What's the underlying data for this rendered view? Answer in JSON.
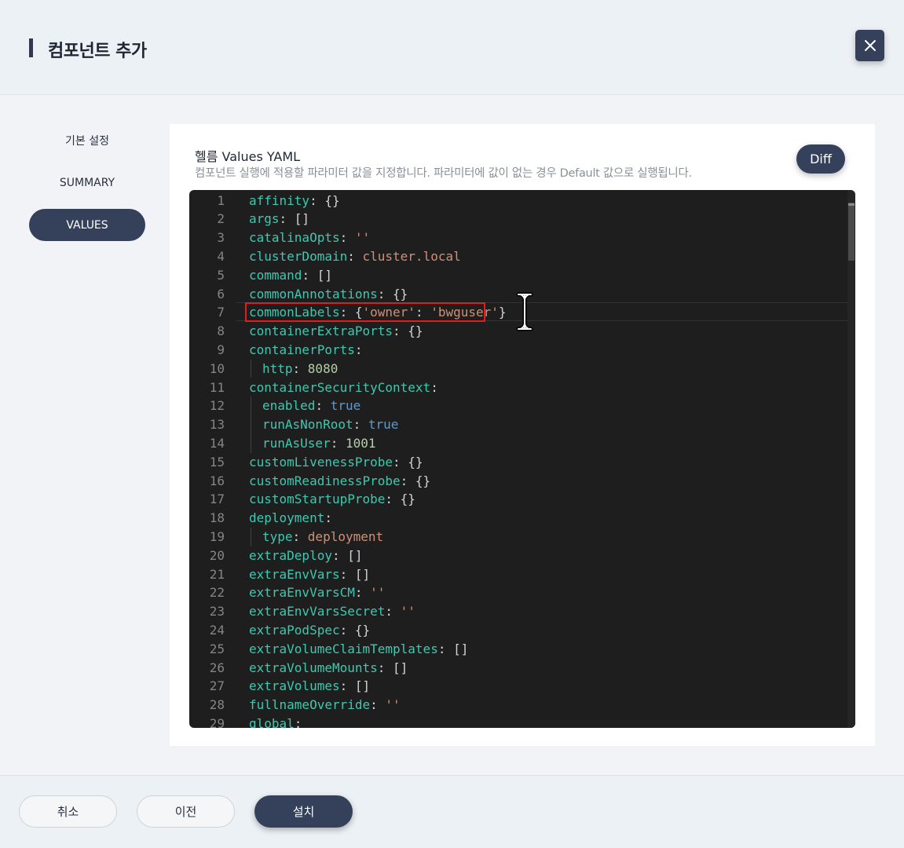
{
  "header": {
    "title": "컴포넌트 추가",
    "close_icon": "close-icon"
  },
  "sidebar": {
    "items": [
      {
        "label": "기본 설정",
        "active": false
      },
      {
        "label": "SUMMARY",
        "active": false
      },
      {
        "label": "VALUES",
        "active": true
      }
    ]
  },
  "panel": {
    "title": "헬름 Values YAML",
    "description": "컴포넌트 실행에 적용할 파라미터 값을 지정합니다. 파라미터에 값이 없는 경우 Default 값으로 실행됩니다.",
    "diff_label": "Diff"
  },
  "editor": {
    "highlighted_line": 7,
    "lines": [
      {
        "n": "1",
        "indent": false,
        "tokens": [
          [
            "k",
            "affinity"
          ],
          [
            "p",
            ": {}"
          ]
        ]
      },
      {
        "n": "2",
        "indent": false,
        "tokens": [
          [
            "k",
            "args"
          ],
          [
            "p",
            ": []"
          ]
        ]
      },
      {
        "n": "3",
        "indent": false,
        "tokens": [
          [
            "k",
            "catalinaOpts"
          ],
          [
            "p",
            ": "
          ],
          [
            "s",
            "''"
          ]
        ]
      },
      {
        "n": "4",
        "indent": false,
        "tokens": [
          [
            "k",
            "clusterDomain"
          ],
          [
            "p",
            ": "
          ],
          [
            "s",
            "cluster.local"
          ]
        ]
      },
      {
        "n": "5",
        "indent": false,
        "tokens": [
          [
            "k",
            "command"
          ],
          [
            "p",
            ": []"
          ]
        ]
      },
      {
        "n": "6",
        "indent": false,
        "tokens": [
          [
            "k",
            "commonAnnotations"
          ],
          [
            "p",
            ": {}"
          ]
        ]
      },
      {
        "n": "7",
        "indent": false,
        "tokens": [
          [
            "k",
            "commonLabels"
          ],
          [
            "p",
            ": {"
          ],
          [
            "s",
            "'owner'"
          ],
          [
            "p",
            ": "
          ],
          [
            "s",
            "'bwguser'"
          ],
          [
            "p",
            "}"
          ]
        ]
      },
      {
        "n": "8",
        "indent": false,
        "tokens": [
          [
            "k",
            "containerExtraPorts"
          ],
          [
            "p",
            ": {}"
          ]
        ]
      },
      {
        "n": "9",
        "indent": false,
        "tokens": [
          [
            "k",
            "containerPorts"
          ],
          [
            "p",
            ":"
          ]
        ]
      },
      {
        "n": "10",
        "indent": true,
        "tokens": [
          [
            "k",
            "http"
          ],
          [
            "p",
            ": "
          ],
          [
            "n",
            "8080"
          ]
        ]
      },
      {
        "n": "11",
        "indent": false,
        "tokens": [
          [
            "k",
            "containerSecurityContext"
          ],
          [
            "p",
            ":"
          ]
        ]
      },
      {
        "n": "12",
        "indent": true,
        "tokens": [
          [
            "k",
            "enabled"
          ],
          [
            "p",
            ": "
          ],
          [
            "b",
            "true"
          ]
        ]
      },
      {
        "n": "13",
        "indent": true,
        "tokens": [
          [
            "k",
            "runAsNonRoot"
          ],
          [
            "p",
            ": "
          ],
          [
            "b",
            "true"
          ]
        ]
      },
      {
        "n": "14",
        "indent": true,
        "tokens": [
          [
            "k",
            "runAsUser"
          ],
          [
            "p",
            ": "
          ],
          [
            "n",
            "1001"
          ]
        ]
      },
      {
        "n": "15",
        "indent": false,
        "tokens": [
          [
            "k",
            "customLivenessProbe"
          ],
          [
            "p",
            ": {}"
          ]
        ]
      },
      {
        "n": "16",
        "indent": false,
        "tokens": [
          [
            "k",
            "customReadinessProbe"
          ],
          [
            "p",
            ": {}"
          ]
        ]
      },
      {
        "n": "17",
        "indent": false,
        "tokens": [
          [
            "k",
            "customStartupProbe"
          ],
          [
            "p",
            ": {}"
          ]
        ]
      },
      {
        "n": "18",
        "indent": false,
        "tokens": [
          [
            "k",
            "deployment"
          ],
          [
            "p",
            ":"
          ]
        ]
      },
      {
        "n": "19",
        "indent": true,
        "tokens": [
          [
            "k",
            "type"
          ],
          [
            "p",
            ": "
          ],
          [
            "s",
            "deployment"
          ]
        ]
      },
      {
        "n": "20",
        "indent": false,
        "tokens": [
          [
            "k",
            "extraDeploy"
          ],
          [
            "p",
            ": []"
          ]
        ]
      },
      {
        "n": "21",
        "indent": false,
        "tokens": [
          [
            "k",
            "extraEnvVars"
          ],
          [
            "p",
            ": []"
          ]
        ]
      },
      {
        "n": "22",
        "indent": false,
        "tokens": [
          [
            "k",
            "extraEnvVarsCM"
          ],
          [
            "p",
            ": "
          ],
          [
            "s",
            "''"
          ]
        ]
      },
      {
        "n": "23",
        "indent": false,
        "tokens": [
          [
            "k",
            "extraEnvVarsSecret"
          ],
          [
            "p",
            ": "
          ],
          [
            "s",
            "''"
          ]
        ]
      },
      {
        "n": "24",
        "indent": false,
        "tokens": [
          [
            "k",
            "extraPodSpec"
          ],
          [
            "p",
            ": {}"
          ]
        ]
      },
      {
        "n": "25",
        "indent": false,
        "tokens": [
          [
            "k",
            "extraVolumeClaimTemplates"
          ],
          [
            "p",
            ": []"
          ]
        ]
      },
      {
        "n": "26",
        "indent": false,
        "tokens": [
          [
            "k",
            "extraVolumeMounts"
          ],
          [
            "p",
            ": []"
          ]
        ]
      },
      {
        "n": "27",
        "indent": false,
        "tokens": [
          [
            "k",
            "extraVolumes"
          ],
          [
            "p",
            ": []"
          ]
        ]
      },
      {
        "n": "28",
        "indent": false,
        "tokens": [
          [
            "k",
            "fullnameOverride"
          ],
          [
            "p",
            ": "
          ],
          [
            "s",
            "''"
          ]
        ]
      },
      {
        "n": "29",
        "indent": false,
        "tokens": [
          [
            "k",
            "global"
          ],
          [
            "p",
            ":"
          ]
        ]
      }
    ]
  },
  "footer": {
    "cancel_label": "취소",
    "prev_label": "이전",
    "install_label": "설치"
  }
}
